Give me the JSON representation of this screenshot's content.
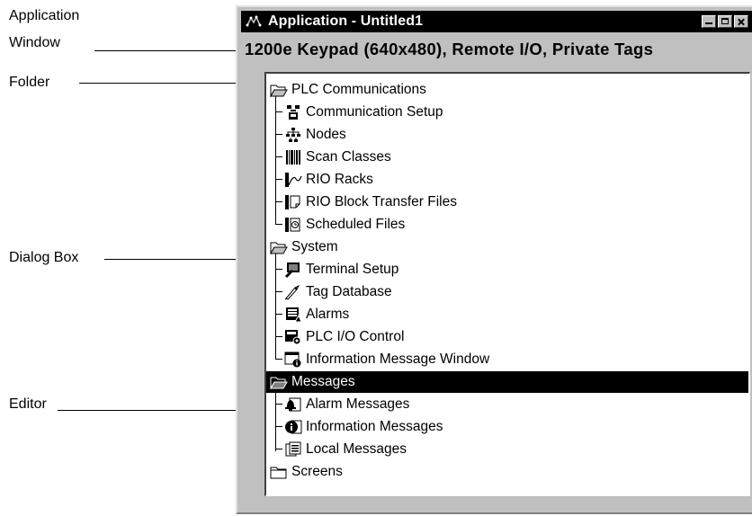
{
  "callouts": {
    "application_window": [
      "Application",
      "Window"
    ],
    "folder": "Folder",
    "dialog_box": "Dialog Box",
    "editor": "Editor"
  },
  "window": {
    "title": "Application - Untitled1",
    "subtitle": "1200e Keypad (640x480), Remote I/O, Private Tags"
  },
  "tree": {
    "plc_communications": {
      "label": "PLC Communications",
      "items": [
        "Communication Setup",
        "Nodes",
        "Scan Classes",
        "RIO Racks",
        "RIO Block Transfer Files",
        "Scheduled Files"
      ]
    },
    "system": {
      "label": "System",
      "items": [
        "Terminal Setup",
        "Tag Database",
        "Alarms",
        "PLC I/O Control",
        "Information Message Window"
      ]
    },
    "messages": {
      "label": "Messages",
      "items": [
        "Alarm Messages",
        "Information Messages",
        "Local Messages"
      ]
    },
    "screens": {
      "label": "Screens"
    }
  },
  "colors": {
    "selection": "#000000",
    "window_face": "#c0c0c0",
    "titlebar": "#000000"
  }
}
